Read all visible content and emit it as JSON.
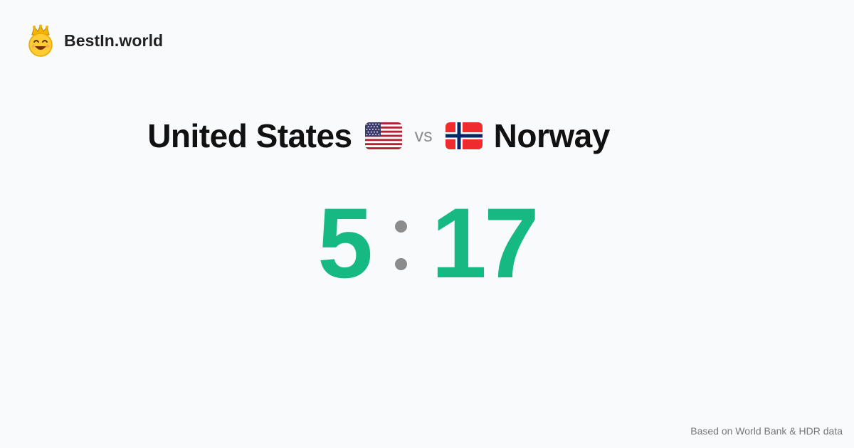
{
  "brand": {
    "name": "BestIn.world",
    "logo_icon": "crown-smiley-icon"
  },
  "comparison": {
    "left_country": "United States",
    "left_flag_icon": "us-flag-icon",
    "vs_label": "vs",
    "right_country": "Norway",
    "right_flag_icon": "norway-flag-icon"
  },
  "score": {
    "left": "5",
    "right": "17",
    "color": "#16b981"
  },
  "footer": {
    "source_note": "Based on World Bank & HDR data"
  }
}
